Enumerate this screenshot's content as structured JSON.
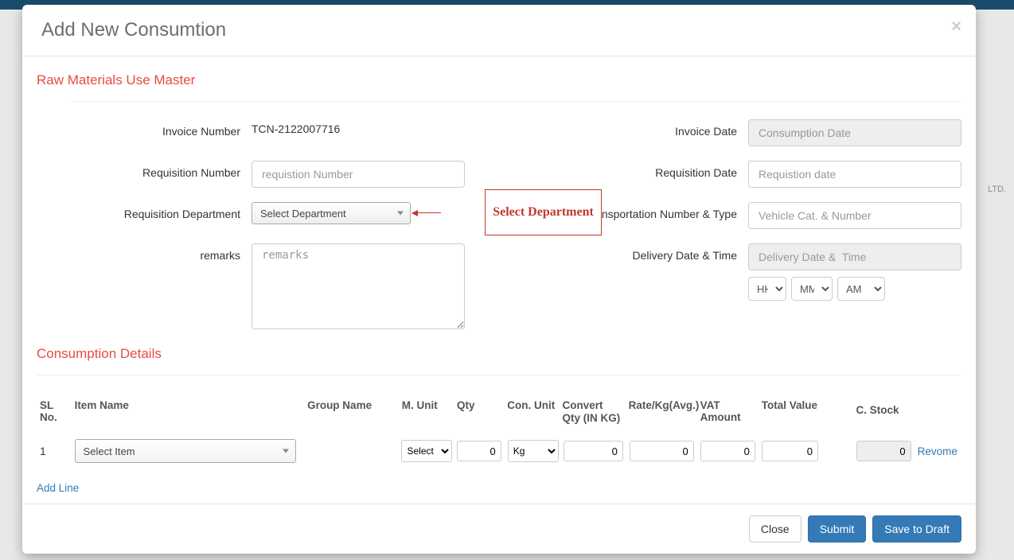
{
  "bg": {
    "ltd_text": "LTD."
  },
  "modal": {
    "title": "Add New Consumtion",
    "close_glyph": "×",
    "sections": {
      "master_title": "Raw Materials Use Master",
      "details_title": "Consumption Details"
    },
    "labels": {
      "invoice_number": "Invoice Number",
      "invoice_date": "Invoice Date",
      "requisition_number": "Requisition Number",
      "requisition_date": "Requisition Date",
      "requisition_department": "Requisition Department",
      "transportation": "Transportation Number & Type",
      "remarks": "remarks",
      "delivery": "Delivery Date & Time"
    },
    "values": {
      "invoice_number": "TCN-2122007716",
      "requisition_department": "Select Department"
    },
    "placeholders": {
      "consumption_date": "Consumption Date",
      "requisition_number": "requistion Number",
      "requisition_date": "Requistion date",
      "vehicle": "Vehicle Cat. & Number",
      "remarks": "remarks",
      "delivery_date": "Delivery Date &  Time"
    },
    "time": {
      "hh": "HH",
      "mm": "MM",
      "ampm": "AM"
    },
    "callout": "Select Department",
    "table": {
      "headers": {
        "sl": "SL No.",
        "item": "Item Name",
        "group": "Group Name",
        "munit": "M. Unit",
        "qty": "Qty",
        "cunit": "Con. Unit",
        "cqty": "Convert Qty (IN KG)",
        "rate": "Rate/Kg(Avg.)",
        "vat": "VAT Amount",
        "tval": "Total Value",
        "cstock": "C. Stock"
      },
      "row": {
        "sl": "1",
        "item_placeholder": "Select Item",
        "munit_placeholder": "Select U",
        "qty": "0",
        "cunit": "Kg",
        "cqty": "0",
        "rate": "0",
        "vat": "0",
        "tval": "0",
        "cstock": "0",
        "remove": "Revome"
      },
      "add_line": "Add Line"
    },
    "footer": {
      "close": "Close",
      "submit": "Submit",
      "save_draft": "Save to Draft"
    }
  }
}
